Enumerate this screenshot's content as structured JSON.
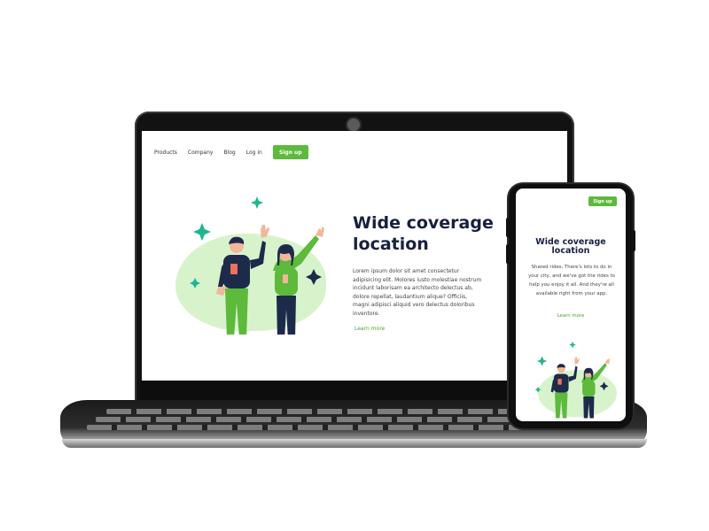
{
  "desktop": {
    "nav": {
      "links": [
        "Products",
        "Company",
        "Blog",
        "Log in"
      ],
      "signup_label": "Sign up"
    },
    "hero": {
      "title_line1": "Wide coverage",
      "title_line2": "location",
      "body": "Lorem ipsum dolor sit amet consectetur adipisicing elit. Molores iusto molestiae nostrum incidunt laborisam ea architecto delectus ab, dolore repellat, laudantium alique? Officiis, magni adipisci aliquid vero delectus doloribus inventore.",
      "link_label": "Learn more"
    }
  },
  "mobile": {
    "signup_label": "Sign up",
    "title_line1": "Wide coverage",
    "title_line2": "location",
    "body": "Shared rides, There's lots to do in your city, and we've got the rides to help you enjoy it all. And they're all available right from your app.",
    "link_label": "Learn more"
  },
  "colors": {
    "accent": "#5dba3b",
    "title": "#17203e",
    "blob": "#d7f3cc",
    "figure_navy": "#1e2a4a"
  },
  "icons": [
    "sparkle-icon",
    "phone-icon"
  ]
}
